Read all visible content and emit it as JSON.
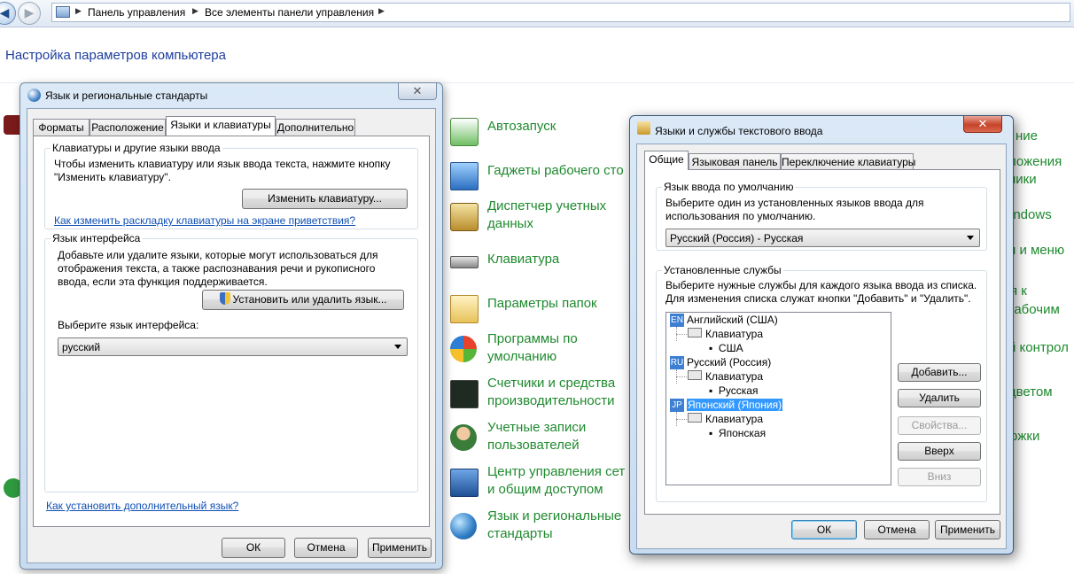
{
  "explorer": {
    "breadcrumb": [
      "Панель управления",
      "Все элементы панели управления"
    ],
    "page_title": "Настройка параметров компьютера",
    "items": [
      {
        "label": "Автозапуск"
      },
      {
        "label": "Гаджеты рабочего сто"
      },
      {
        "label": "Диспетчер учетных\nданных"
      },
      {
        "label": "Клавиатура"
      },
      {
        "label": "Параметры папок"
      },
      {
        "label": "Программы по\nумолчанию"
      },
      {
        "label": "Счетчики и средства\nпроизводительности"
      },
      {
        "label": "Учетные записи\nпользователей"
      },
      {
        "label": "Центр управления сет\nи общим доступом"
      },
      {
        "label": "Язык и региональные\nстандарты"
      }
    ],
    "right_fragments": [
      "ние",
      "ложения",
      "ники",
      "indows",
      "н и меню",
      "я к",
      "рабочим",
      "й контрол",
      "цветом",
      "ржки"
    ]
  },
  "regional_dialog": {
    "title": "Язык и региональные стандарты",
    "tabs": [
      "Форматы",
      "Расположение",
      "Языки и клавиатуры",
      "Дополнительно"
    ],
    "active_tab": 2,
    "keyboards_group": {
      "title": "Клавиатуры и другие языки ввода",
      "description": "Чтобы изменить клавиатуру или язык ввода текста, нажмите кнопку \"Изменить клавиатуру\".",
      "change_button": "Изменить клавиатуру...",
      "welcome_link": "Как изменить раскладку клавиатуры на экране приветствия?"
    },
    "interface_group": {
      "title": "Язык интерфейса",
      "description": "Добавьте или удалите языки, которые могут использоваться для отображения текста, а также распознавания речи и рукописного ввода, если эта функция поддерживается.",
      "install_button": "Установить или удалить язык...",
      "select_label": "Выберите язык интерфейса:",
      "selected_language": "русский"
    },
    "additional_link": "Как установить дополнительный язык?",
    "ok": "ОК",
    "cancel": "Отмена",
    "apply": "Применить"
  },
  "text_services_dialog": {
    "title": "Языки и службы текстового ввода",
    "tabs": [
      "Общие",
      "Языковая панель",
      "Переключение клавиатуры"
    ],
    "active_tab": 0,
    "default_group": {
      "title": "Язык ввода по умолчанию",
      "description": "Выберите один из установленных языков ввода для использования по умолчанию.",
      "selected": "Русский (Россия) - Русская"
    },
    "services_group": {
      "title": "Установленные службы",
      "description": "Выберите нужные службы для каждого языка ввода из списка. Для изменения списка служат кнопки \"Добавить\" и \"Удалить\"."
    },
    "tree": [
      {
        "badge": "EN",
        "language": "Английский (США)",
        "category": "Клавиатура",
        "layout": "США",
        "selected": false
      },
      {
        "badge": "RU",
        "language": "Русский (Россия)",
        "category": "Клавиатура",
        "layout": "Русская",
        "selected": false
      },
      {
        "badge": "JP",
        "language": "Японский (Япония)",
        "category": "Клавиатура",
        "layout": "Японская",
        "selected": true
      }
    ],
    "buttons": {
      "add": "Добавить...",
      "remove": "Удалить",
      "properties": "Свойства...",
      "up": "Вверх",
      "down": "Вниз"
    },
    "ok": "ОК",
    "cancel": "Отмена",
    "apply": "Применить"
  }
}
